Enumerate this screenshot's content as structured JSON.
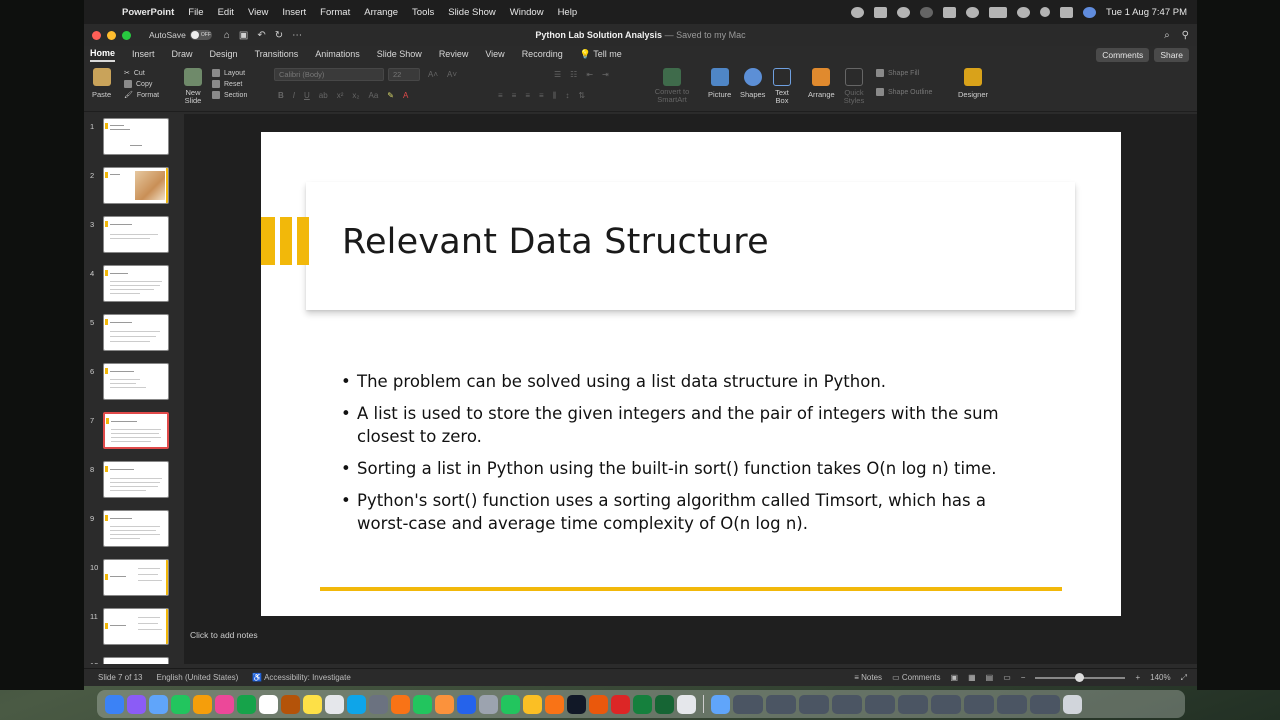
{
  "menubar": {
    "app_name": "PowerPoint",
    "items": [
      "File",
      "Edit",
      "View",
      "Insert",
      "Format",
      "Arrange",
      "Tools",
      "Slide Show",
      "Window",
      "Help"
    ],
    "datetime": "Tue 1 Aug  7:47 PM"
  },
  "titlebar": {
    "autosave_label": "AutoSave",
    "autosave_state": "OFF",
    "doc_name": "Python Lab Solution Analysis",
    "saved_status": "— Saved to my Mac"
  },
  "tabs": [
    "Home",
    "Insert",
    "Draw",
    "Design",
    "Transitions",
    "Animations",
    "Slide Show",
    "Review",
    "View",
    "Recording",
    "Tell me"
  ],
  "tab_buttons": {
    "comments": "Comments",
    "share": "Share"
  },
  "ribbon": {
    "paste": "Paste",
    "cut": "Cut",
    "copy": "Copy",
    "format": "Format",
    "new_slide": "New Slide",
    "layout": "Layout",
    "reset": "Reset",
    "section": "Section",
    "font_name": "Calibri (Body)",
    "font_size": "22",
    "convert_smartart": "Convert to SmartArt",
    "picture": "Picture",
    "shapes": "Shapes",
    "text_box": "Text Box",
    "arrange": "Arrange",
    "quick_styles": "Quick Styles",
    "shape_fill": "Shape Fill",
    "shape_outline": "Shape Outline",
    "designer": "Designer"
  },
  "thumbnails": [
    {
      "num": "1"
    },
    {
      "num": "2"
    },
    {
      "num": "3"
    },
    {
      "num": "4"
    },
    {
      "num": "5"
    },
    {
      "num": "6"
    },
    {
      "num": "7"
    },
    {
      "num": "8"
    },
    {
      "num": "9"
    },
    {
      "num": "10"
    },
    {
      "num": "11"
    },
    {
      "num": "12"
    }
  ],
  "slide": {
    "title": "Relevant Data Structure",
    "bullets": [
      "The problem can be solved using a list data structure in Python.",
      "A list is used to store the given integers and the pair of integers with the sum closest to zero.",
      "Sorting a list in Python using the built-in sort() function takes O(n log n) time.",
      "Python's sort() function uses a sorting algorithm called Timsort, which has a worst-case and average time complexity of O(n log n)."
    ]
  },
  "notes_placeholder": "Click to add notes",
  "statusbar": {
    "slide_info": "Slide 7 of 13",
    "language": "English (United States)",
    "accessibility": "Accessibility: Investigate",
    "notes": "Notes",
    "comments": "Comments",
    "zoom": "140%"
  },
  "colors": {
    "accent_gold": "#f2b80a",
    "selection_red": "#e04a4a"
  }
}
